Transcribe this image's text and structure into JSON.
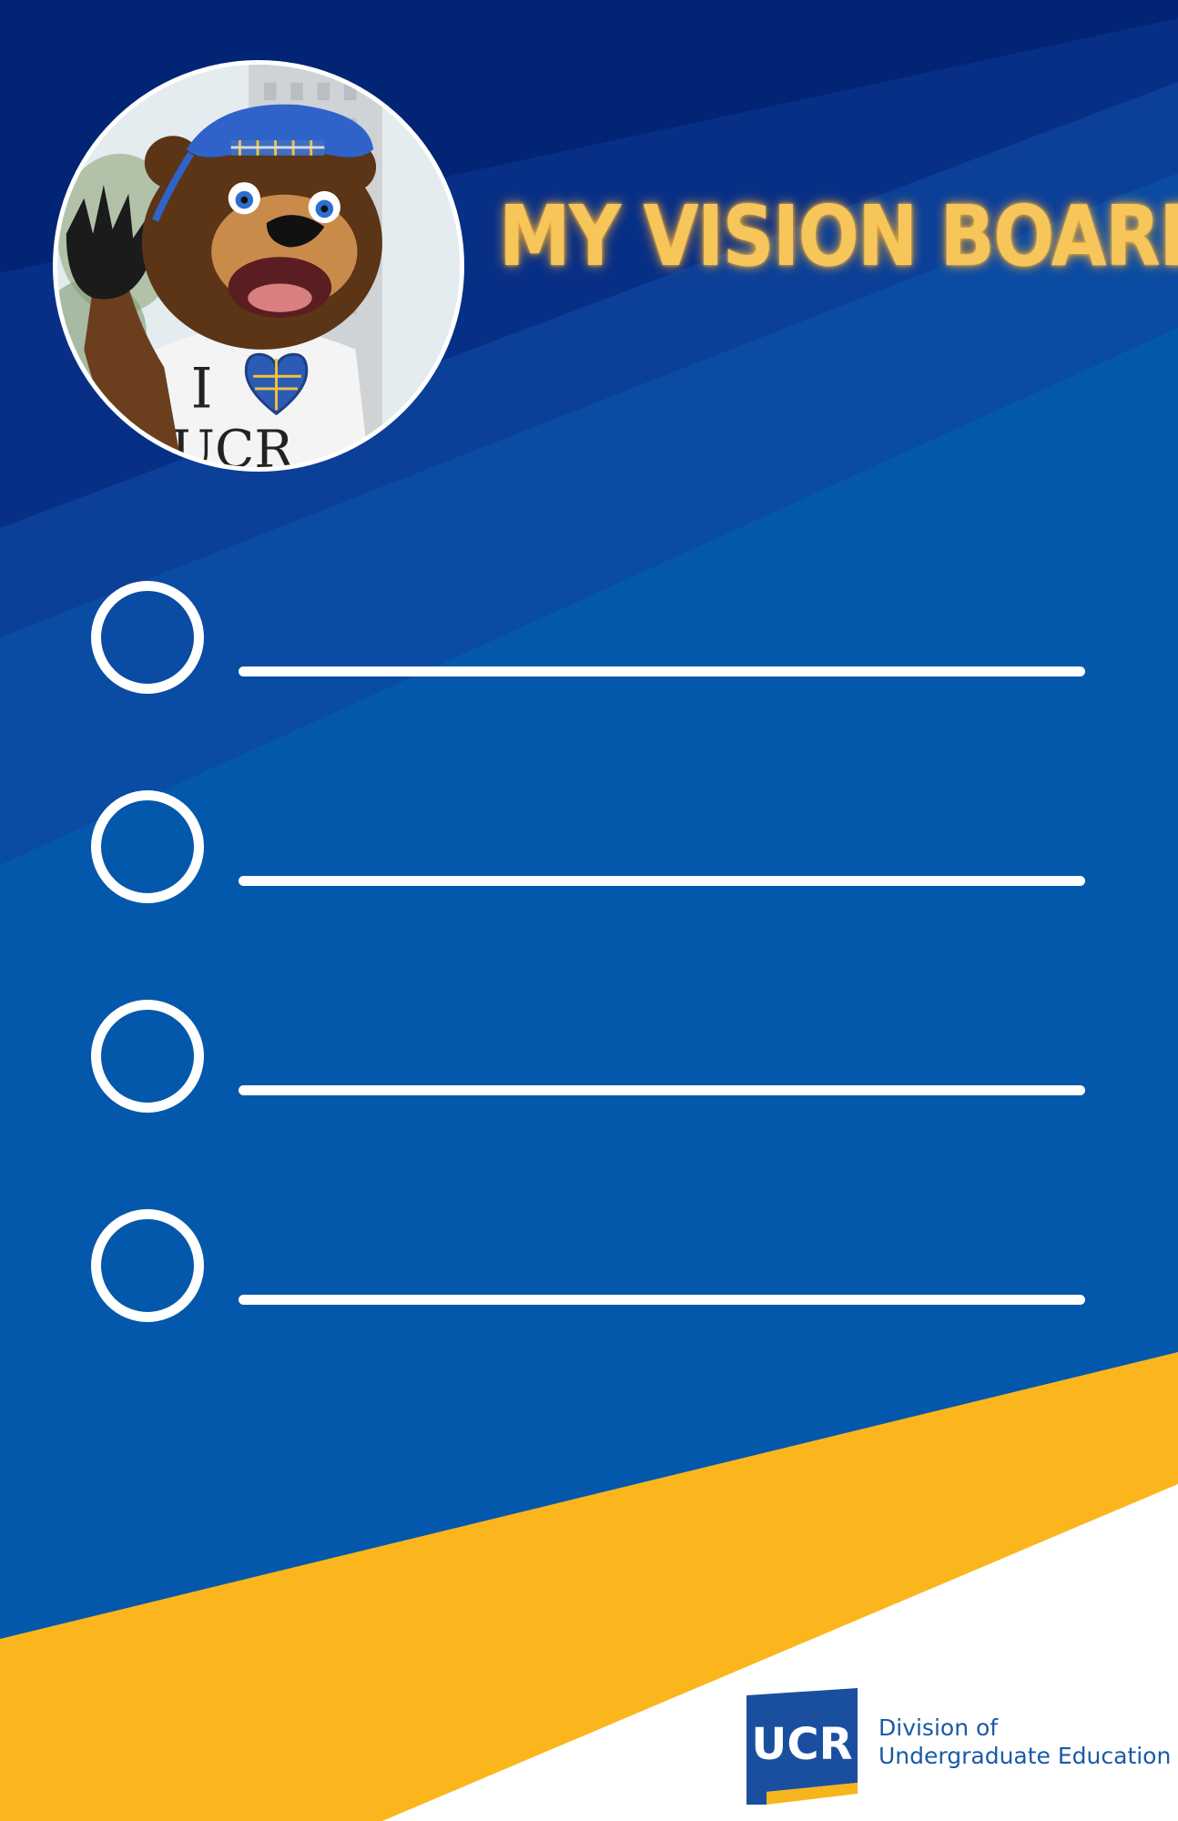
{
  "title": "MY VISION BOARD",
  "avatar": {
    "subject": "bear-mascot-photo",
    "shirt_letter_top": "I",
    "shirt_letter_bottom": "UCR"
  },
  "checklist": {
    "items": [
      {
        "checked": false,
        "text": ""
      },
      {
        "checked": false,
        "text": ""
      },
      {
        "checked": false,
        "text": ""
      },
      {
        "checked": false,
        "text": ""
      }
    ]
  },
  "footer": {
    "logo_mark": "UCR",
    "line1": "Division of",
    "line2": "Undergraduate Education"
  },
  "colors": {
    "dark_navy": "#012475",
    "navy": "#0b3f98",
    "blue": "#0458ab",
    "gold": "#fbb61d",
    "title_glow": "#f7c65a",
    "white": "#ffffff",
    "logo_blue": "#1a5aa6"
  }
}
